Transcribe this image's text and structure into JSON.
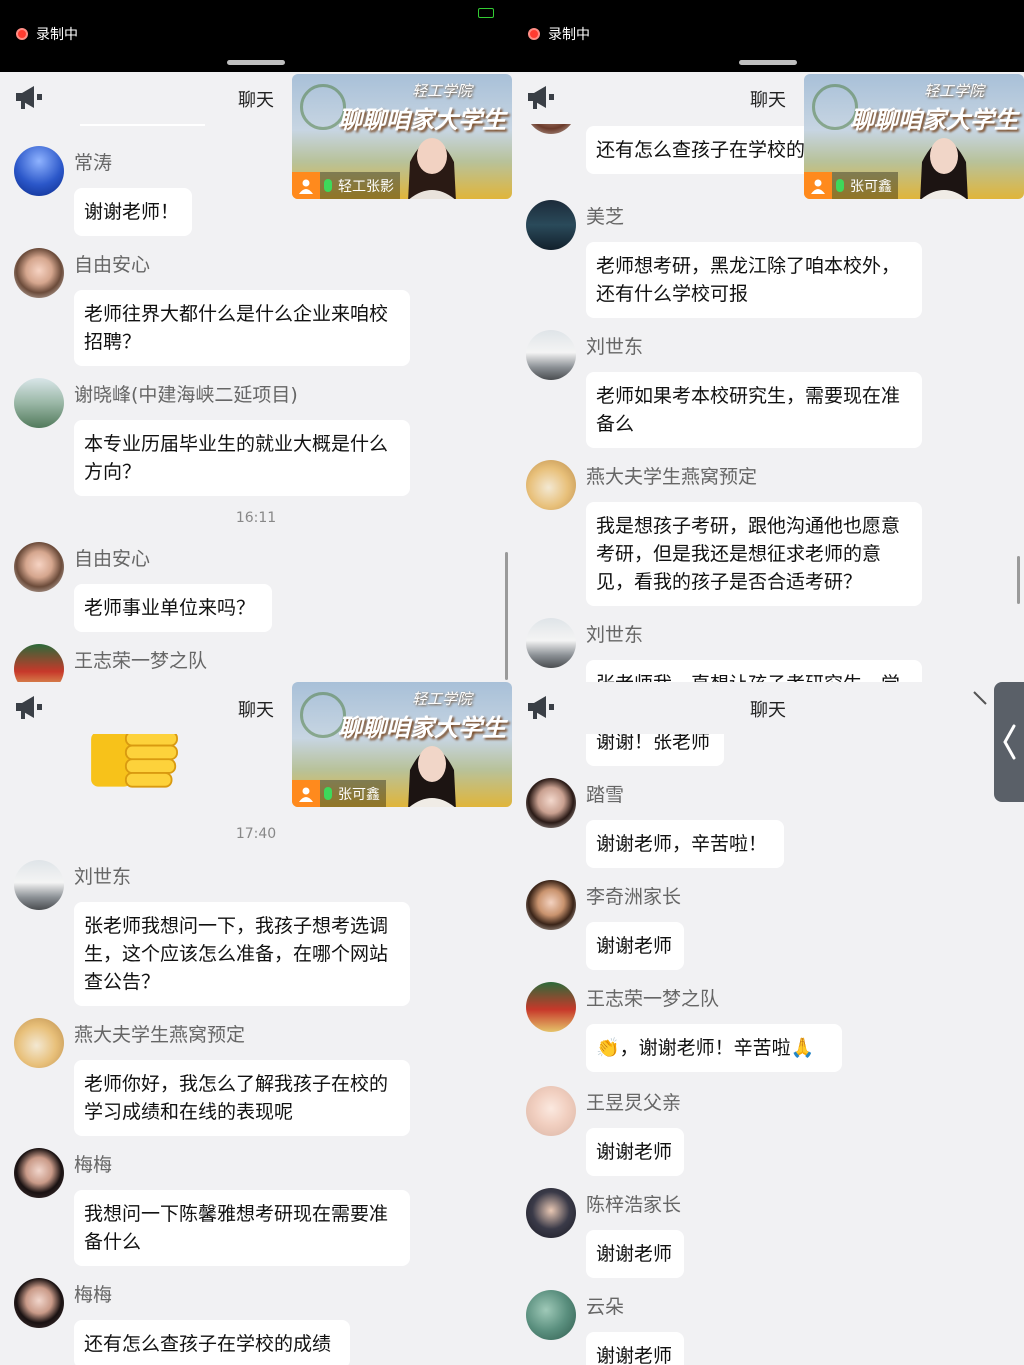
{
  "status": {
    "recording_label": "录制中"
  },
  "chat": {
    "title": "聊天"
  },
  "video_overlay": {
    "line1": "轻工学院",
    "line2": "聊聊咱家大学生"
  },
  "panel_tl": {
    "speaker": "轻工张影",
    "messages": [
      {
        "name": "常涛",
        "text": "谢谢老师！"
      },
      {
        "name": "自由安心",
        "text": "老师往界大都什么是什么企业来咱校招聘？"
      },
      {
        "name": "谢晓峰(中建海峡二延项目)",
        "text": "本专业历届毕业生的就业大概是什么方向？"
      },
      {
        "name": "自由安心",
        "text": "老师事业单位来吗？"
      },
      {
        "name": "王志荣一梦之队",
        "text": ""
      }
    ],
    "time": "16:11"
  },
  "panel_tr": {
    "speaker": "张可鑫",
    "messages": [
      {
        "name": "",
        "text": "还有怎么查孩子在学校的"
      },
      {
        "name": "美芝",
        "text": "老师想考研，黑龙江除了咱本校外，还有什么学校可报"
      },
      {
        "name": "刘世东",
        "text": "老师如果考本校研究生，需要现在准备么"
      },
      {
        "name": "燕大夫学生燕窝预定",
        "text": "我是想孩子考研，跟他沟通他也愿意考研，但是我还是想征求老师的意见，看我的孩子是否合适考研？"
      },
      {
        "name": "刘世东",
        "text": "张老师我一直想让孩子考研究生，觉"
      }
    ]
  },
  "panel_bl": {
    "speaker": "张可鑫",
    "time": "17:40",
    "messages": [
      {
        "name": "刘世东",
        "text": "张老师我想问一下，我孩子想考选调生，这个应该怎么准备，在哪个网站查公告？"
      },
      {
        "name": "燕大夫学生燕窝预定",
        "text": "老师你好，我怎么了解我孩子在校的学习成绩和在线的表现呢"
      },
      {
        "name": "梅梅",
        "text": "我想问一下陈馨雅想考研现在需要准备什么"
      },
      {
        "name": "梅梅",
        "text": "还有怎么查孩子在学校的成绩"
      }
    ]
  },
  "panel_br": {
    "messages": [
      {
        "name": "",
        "text": "谢谢！张老师"
      },
      {
        "name": "踏雪",
        "text": "谢谢老师，辛苦啦！"
      },
      {
        "name": "李奇洲家长",
        "text": "谢谢老师"
      },
      {
        "name": "王志荣一梦之队",
        "text": "👏，谢谢老师！辛苦啦🙏"
      },
      {
        "name": "王昱炅父亲",
        "text": "谢谢老师"
      },
      {
        "name": "陈梓浩家长",
        "text": "谢谢老师"
      },
      {
        "name": "云朵",
        "text": "谢谢老师"
      }
    ]
  },
  "colors": {
    "accent_orange": "#ff8a1d",
    "recording_red": "#ff3b30",
    "panel_bg": "#f1f1f3"
  }
}
